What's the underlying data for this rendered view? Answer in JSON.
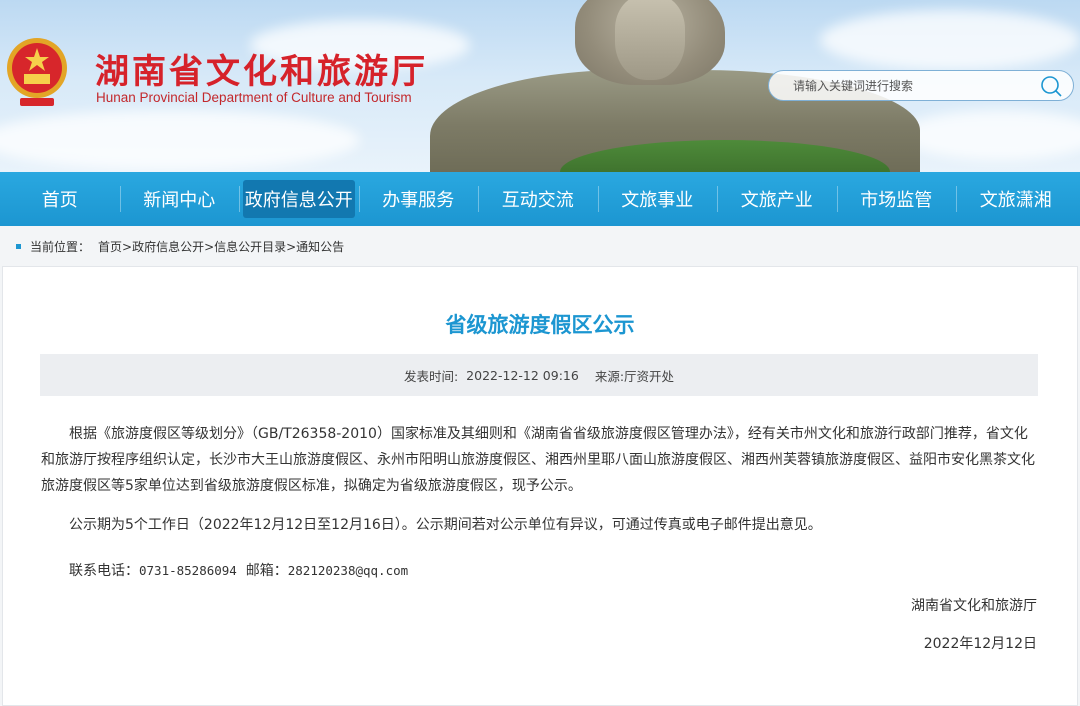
{
  "header": {
    "title_cn": "湖南省文化和旅游厅",
    "title_en": "Hunan Provincial Department of Culture and Tourism",
    "search_placeholder": "请输入关键词进行搜索",
    "emblem_icon": "national-emblem-icon"
  },
  "nav": {
    "items": [
      {
        "label": "首页"
      },
      {
        "label": "新闻中心"
      },
      {
        "label": "政府信息公开",
        "active": true
      },
      {
        "label": "办事服务"
      },
      {
        "label": "互动交流"
      },
      {
        "label": "文旅事业"
      },
      {
        "label": "文旅产业"
      },
      {
        "label": "市场监管"
      },
      {
        "label": "文旅潇湘"
      }
    ]
  },
  "breadcrumb": {
    "prefix": "当前位置：",
    "path": "首页>政府信息公开>信息公开目录>通知公告"
  },
  "article": {
    "title": "省级旅游度假区公示",
    "published_label": "发表时间:",
    "published": "2022-12-12 09:16",
    "source_label": "来源:",
    "source": "厅资开处",
    "paragraph1": "根据《旅游度假区等级划分》（GB/T26358-2010）国家标准及其细则和《湖南省省级旅游度假区管理办法》，经有关市州文化和旅游行政部门推荐，省文化和旅游厅按程序组织认定，长沙市大王山旅游度假区、永州市阳明山旅游度假区、湘西州里耶八面山旅游度假区、湘西州芙蓉镇旅游度假区、益阳市安化黑茶文化旅游度假区等5家单位达到省级旅游度假区标准，拟确定为省级旅游度假区，现予公示。",
    "paragraph2": "公示期为5个工作日（2022年12月12日至12月16日）。公示期间若对公示单位有异议，可通过传真或电子邮件提出意见。",
    "contact_label": "联系电话：",
    "phone": "0731-85286094",
    "email_label": "邮箱：",
    "email": "282120238@qq.com",
    "signature": "湖南省文化和旅游厅",
    "date": "2022年12月12日"
  },
  "colors": {
    "brand_red": "#d6222a",
    "nav_blue": "#1c96d1",
    "title_blue": "#1c96d1"
  }
}
